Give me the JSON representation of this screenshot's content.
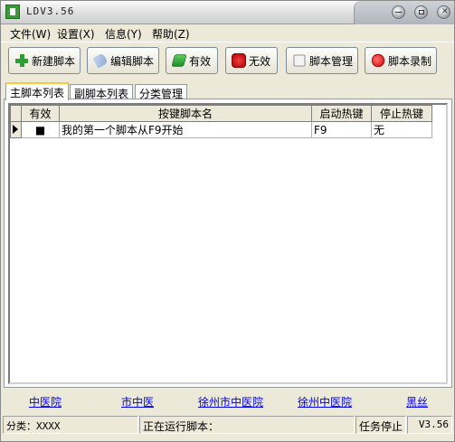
{
  "window": {
    "title": "LDV3.56"
  },
  "menu": [
    {
      "label": "文件(W)"
    },
    {
      "label": "设置(X)"
    },
    {
      "label": "信息(Y)"
    },
    {
      "label": "帮助(Z)"
    }
  ],
  "toolbar": {
    "new_label": "新建脚本",
    "edit_label": "编辑脚本",
    "enable_label": "有效",
    "disable_label": "无效",
    "manage_label": "脚本管理",
    "record_label": "脚本录制"
  },
  "tabs": [
    {
      "label": "主脚本列表"
    },
    {
      "label": "副脚本列表"
    },
    {
      "label": "分类管理"
    }
  ],
  "grid": {
    "columns": [
      "有效",
      "按键脚本名",
      "启动热键",
      "停止热键"
    ],
    "rows": [
      {
        "valid": "■",
        "name": "我的第一个脚本从F9开始",
        "start_key": "F9",
        "stop_key": "无"
      }
    ]
  },
  "links": [
    {
      "label": "中医院"
    },
    {
      "label": "市中医"
    },
    {
      "label": "徐州市中医院"
    },
    {
      "label": "徐州中医院"
    },
    {
      "label": "黑丝"
    }
  ],
  "status": {
    "category": "分类：XXXX",
    "running": "正在运行脚本：",
    "task": "任务停止",
    "version": "V3.56"
  }
}
